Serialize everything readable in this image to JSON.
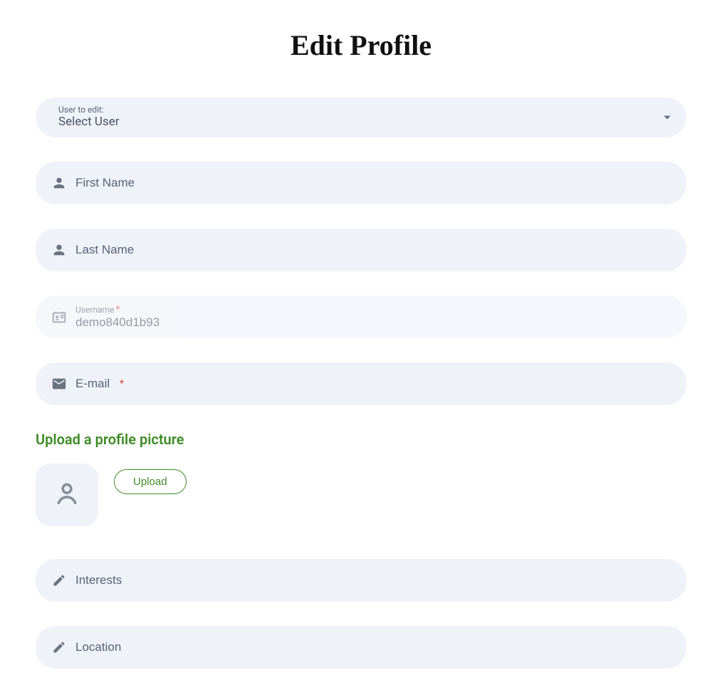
{
  "title": "Edit Profile",
  "userSelect": {
    "label": "User to edit:",
    "selected": "Select User"
  },
  "fields": {
    "firstName": {
      "placeholder": "First Name",
      "value": ""
    },
    "lastName": {
      "placeholder": "Last Name",
      "value": ""
    },
    "username": {
      "label": "Username",
      "value": "demo840d1b93"
    },
    "email": {
      "placeholder": "E-mail",
      "value": ""
    },
    "interests": {
      "placeholder": "Interests",
      "value": ""
    },
    "location": {
      "placeholder": "Location",
      "value": ""
    }
  },
  "upload": {
    "title": "Upload a profile picture",
    "button": "Upload"
  }
}
